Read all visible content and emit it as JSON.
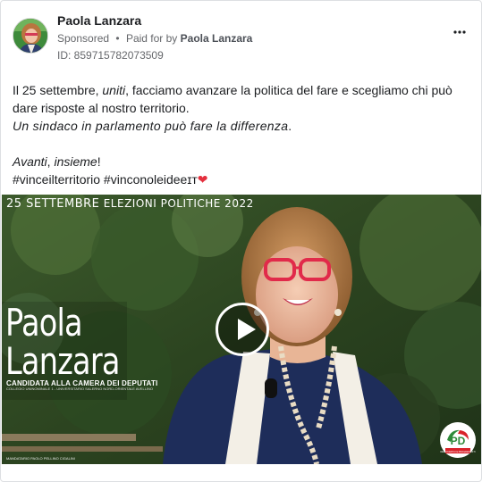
{
  "post": {
    "author": "Paola Lanzara",
    "sponsored_label": "Sponsored",
    "separator": "•",
    "paid_for_prefix": "Paid for by",
    "paid_for_name": "Paola Lanzara",
    "id_label": "ID: 859715782073509",
    "more_label": "•••"
  },
  "body": {
    "line1_a": "Il 25 settembre, ",
    "line1_b": "uniti",
    "line1_c": ", facciamo avanzare la politica del fare e scegliamo chi può dare risposte al nostro territorio.",
    "line2": "Un sindaco in parlamento può fare la differenza",
    "line2_end": ".",
    "line3_a": "Avanti",
    "line3_b": ", ",
    "line3_c": "insieme",
    "line3_d": "!",
    "hashtags": "#vinceilterritorio #vinconoleideeɪᴛ",
    "heart": "❤"
  },
  "video": {
    "top_caption_a": "25 SETTEMBRE",
    "top_caption_b": "ELEZIONI POLITICHE 2022",
    "name_first": "Paola",
    "name_last": "Lanzara",
    "candidate": "CANDIDATA ALLA CAMERA DEI DEPUTATI",
    "candidate_sub": "COLLEGIO UNINOMINALE 1 - UNIVERSITARIO SALERNO NORD-ORIENTALE AVELLINO",
    "mandate": "MANDATARIO PAOLO PELLINO CIGALINI",
    "logo_text": "PD",
    "logo_sub": "DEMOCRATICI E PROGRESSISTI"
  },
  "colors": {
    "accent_heart": "#e4303e",
    "text_primary": "#1c1e21",
    "text_secondary": "#65676b",
    "pd_green": "#2e8b3a",
    "pd_red": "#d8232a"
  }
}
